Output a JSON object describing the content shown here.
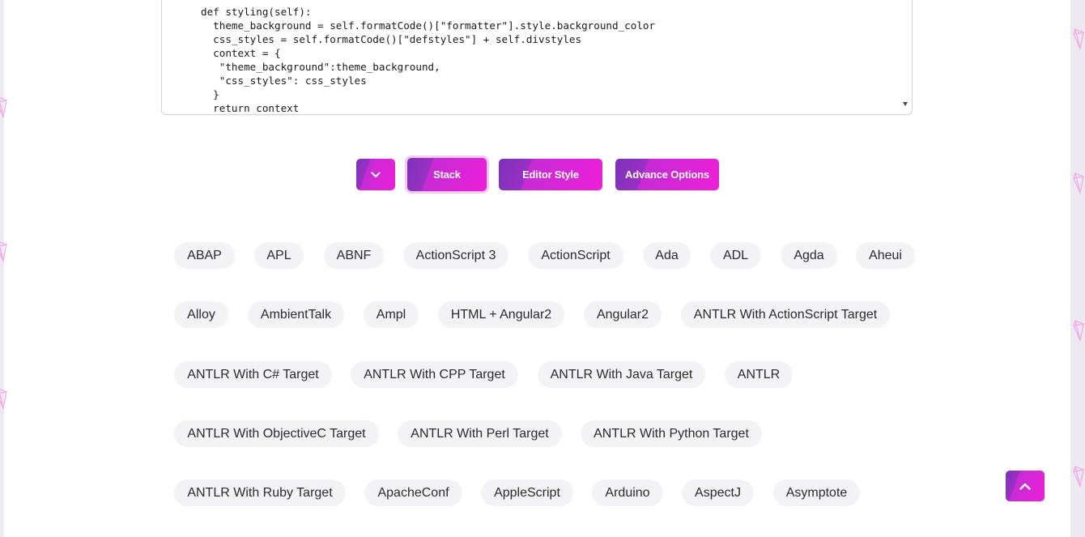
{
  "editor": {
    "code_lines": [
      "def styling(self):",
      "  theme_background = self.formatCode()[\"formatter\"].style.background_color",
      "  css_styles = self.formatCode()[\"defstyles\"] + self.divstyles",
      "  context = {",
      "   \"theme_background\":theme_background,",
      "   \"css_styles\": css_styles",
      "  }",
      "  return context"
    ]
  },
  "toolbar": {
    "stack_label": "Stack",
    "editor_style_label": "Editor Style",
    "advance_options_label": "Advance Options"
  },
  "languages": [
    [
      "ABAP",
      "APL",
      "ABNF",
      "ActionScript 3",
      "ActionScript",
      "Ada",
      "ADL",
      "Agda",
      "Aheui"
    ],
    [
      "Alloy",
      "AmbientTalk",
      "Ampl",
      "HTML + Angular2",
      "Angular2",
      "ANTLR With ActionScript Target"
    ],
    [
      "ANTLR With C# Target",
      "ANTLR With CPP Target",
      "ANTLR With Java Target",
      "ANTLR"
    ],
    [
      "ANTLR With ObjectiveC Target",
      "ANTLR With Perl Target",
      "ANTLR With Python Target"
    ],
    [
      "ANTLR With Ruby Target",
      "ApacheConf",
      "AppleScript",
      "Arduino",
      "AspectJ",
      "Asymptote"
    ]
  ],
  "colors": {
    "accent_start": "#7a33b9",
    "accent_end": "#ec1fd8",
    "chip_bg": "#f3f3f6",
    "stack_ring": "#f6c8f2",
    "side_panel": "#ece9f1"
  },
  "icons": {
    "toggle": "chevron-down-icon",
    "scroll_top": "chevron-up-icon",
    "decoration": "gem-outline-icon"
  }
}
